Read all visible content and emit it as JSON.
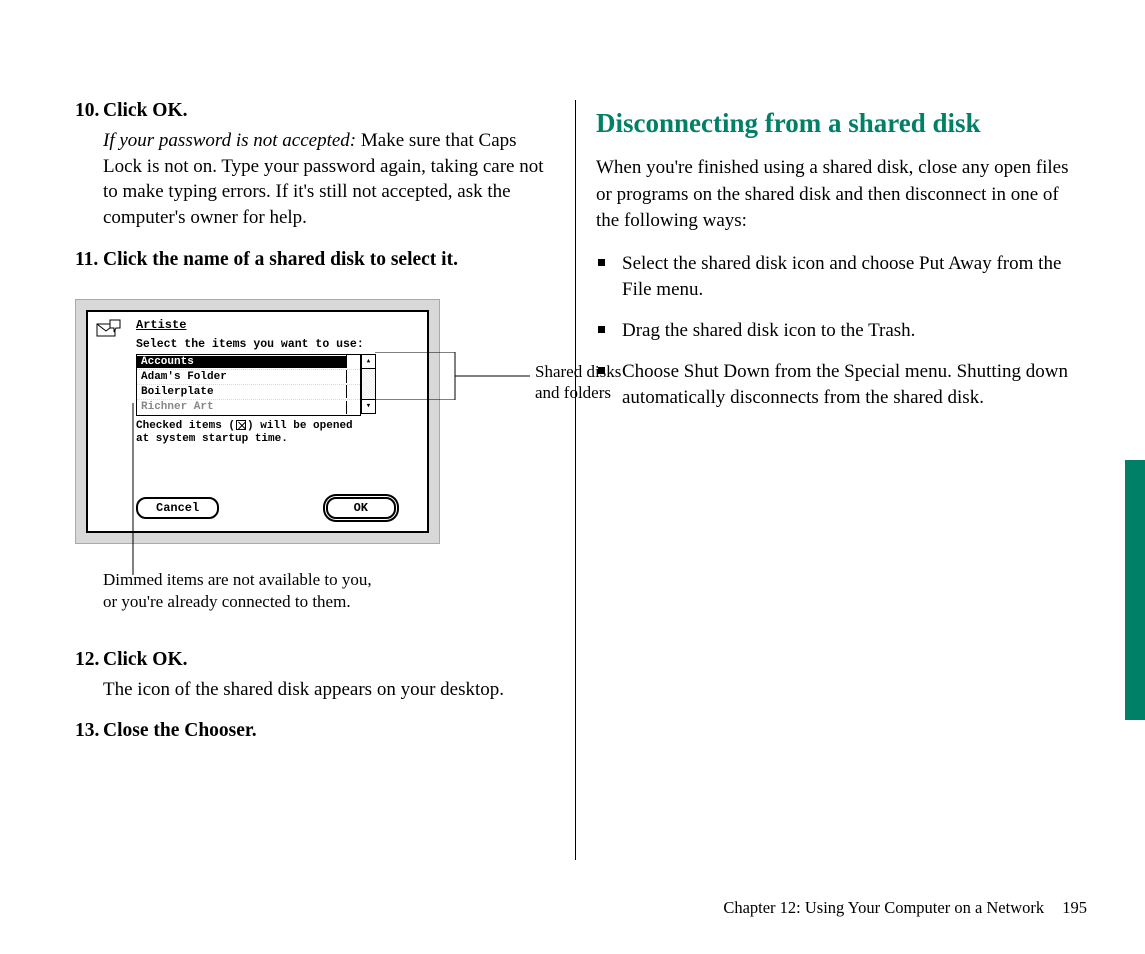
{
  "left": {
    "step10": {
      "num": "10.",
      "title": "Click OK.",
      "lead": "If your password is not accepted:",
      "body": "  Make sure that Caps Lock is not on. Type your password again, taking care not to make typing errors. If it's still not accepted, ask the computer's owner for help."
    },
    "step11": {
      "num": "11.",
      "title": "Click the name of a shared disk to select it."
    },
    "dialog": {
      "title": "Artiste",
      "instruction": "Select the items you want to use:",
      "items": [
        {
          "label": "Accounts",
          "selected": true,
          "dimmed": false
        },
        {
          "label": "Adam's Folder",
          "selected": false,
          "dimmed": false
        },
        {
          "label": "Boilerplate",
          "selected": false,
          "dimmed": false
        },
        {
          "label": "Richner Art",
          "selected": false,
          "dimmed": true
        }
      ],
      "note_pre": "Checked items (",
      "note_post": ") will be opened at system startup time.",
      "cancel": "Cancel",
      "ok": "OK"
    },
    "callout_right_l1": "Shared disks",
    "callout_right_l2": "and folders",
    "callout_bottom_l1": "Dimmed items are not available to you,",
    "callout_bottom_l2": "or you're already connected to them.",
    "step12": {
      "num": "12.",
      "title": "Click OK.",
      "body": "The icon of the shared disk appears on your desktop."
    },
    "step13": {
      "num": "13.",
      "title": "Close the Chooser."
    }
  },
  "right": {
    "heading": "Disconnecting from a shared disk",
    "para": "When you're finished using a shared disk, close any open files or programs on the shared disk and then disconnect in one of the following ways:",
    "bullets": [
      "Select the shared disk icon and choose Put Away from the File menu.",
      "Drag the shared disk icon to the Trash.",
      "Choose Shut Down from the Special menu. Shutting down automatically disconnects from the shared disk."
    ]
  },
  "footer": {
    "chapter": "Chapter 12: Using Your Computer on a Network",
    "page": "195"
  }
}
